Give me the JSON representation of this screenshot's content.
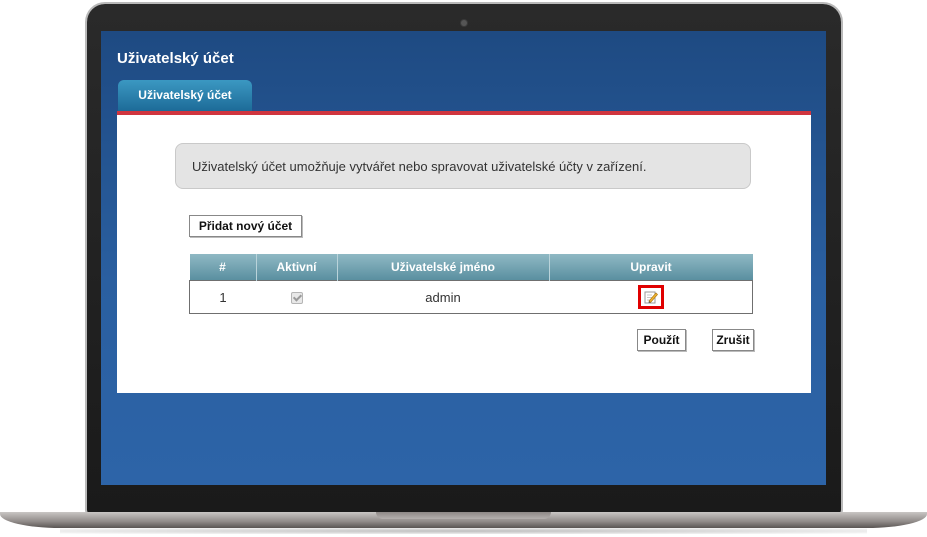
{
  "page": {
    "title": "Uživatelský účet",
    "tab_label": "Uživatelský účet",
    "description": "Uživatelský účet umožňuje vytvářet nebo spravovat uživatelské účty v zařízení."
  },
  "actions": {
    "add_account": "Přidat nový účet",
    "apply": "Použít",
    "cancel": "Zrušit"
  },
  "table": {
    "columns": [
      "#",
      "Aktivní",
      "Uživatelské jméno",
      "Upravit"
    ],
    "rows": [
      {
        "index": "1",
        "active": true,
        "username": "admin",
        "edit_icon": "edit-icon"
      }
    ]
  },
  "colors": {
    "accent_red": "#d0353f",
    "highlight_box": "#e00000",
    "screen_blue": "#1e4a82",
    "tab_blue": "#1d6b98",
    "header_teal": "#5a8fa0"
  }
}
